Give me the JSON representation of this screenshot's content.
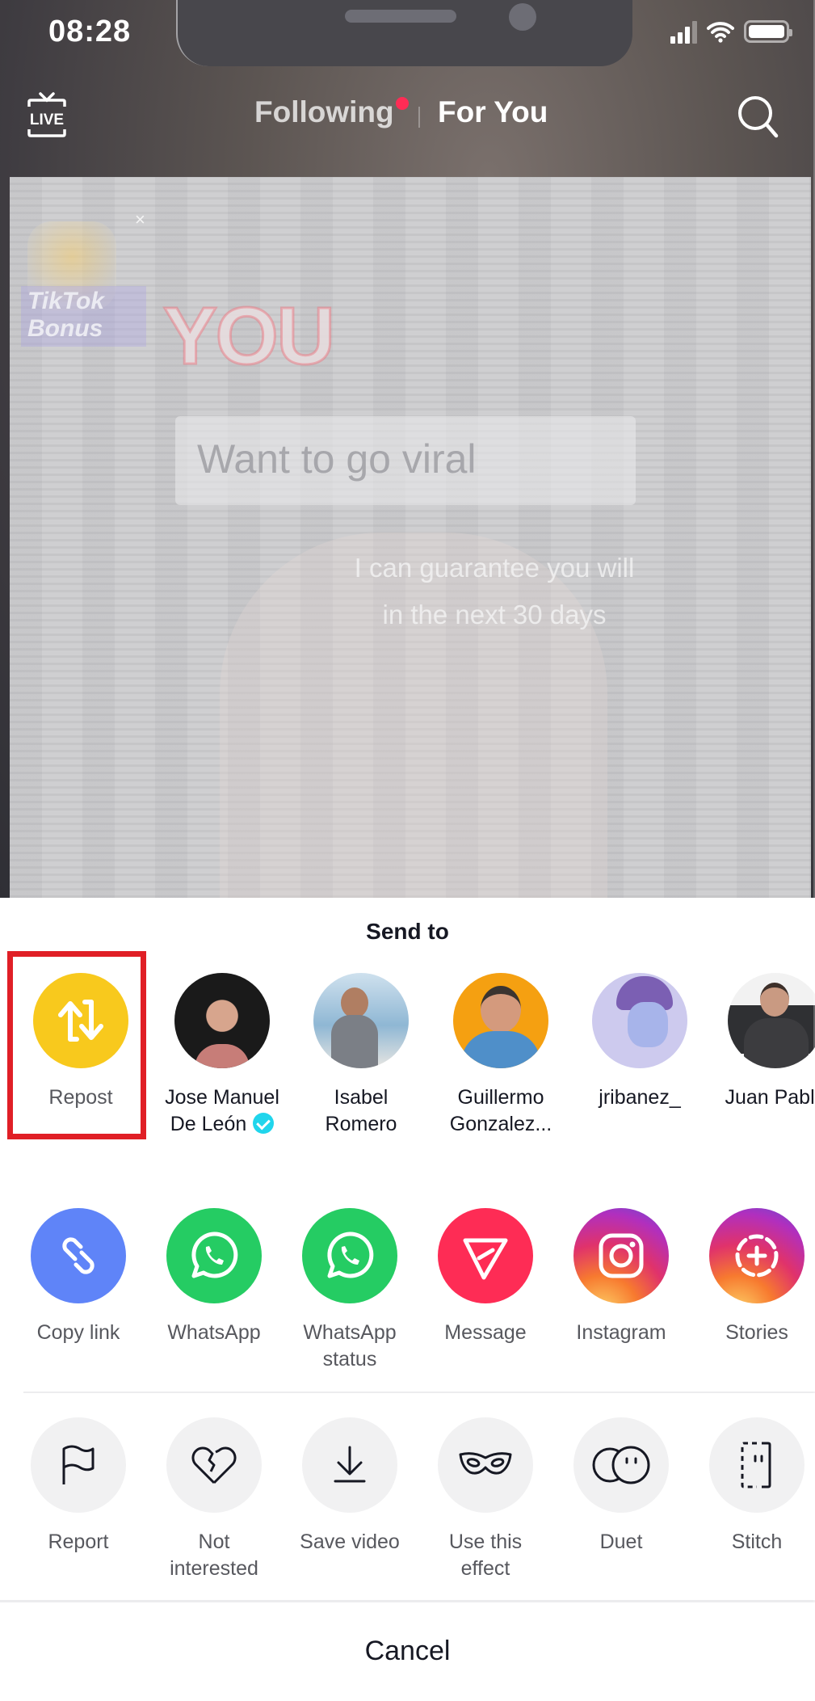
{
  "status_bar": {
    "time": "08:28"
  },
  "top_nav": {
    "live_label": "LIVE",
    "tabs": [
      {
        "label": "Following",
        "active": false,
        "has_notification_dot": true
      },
      {
        "label": "For You",
        "active": true
      }
    ]
  },
  "video": {
    "overlay_badge": "TikTok Bonus",
    "headline": "YOU",
    "caption_box": "Want to go viral",
    "caption_lines": [
      "I can guarantee you will",
      "in the next 30 days"
    ]
  },
  "share_sheet": {
    "title": "Send to",
    "contacts": [
      {
        "label": "Repost",
        "type": "action",
        "color": "#f8c91d",
        "highlighted": true
      },
      {
        "label": "Jose Manuel De León",
        "line1": "Jose Manuel",
        "line2": "De León",
        "verified": true,
        "avatar_bg": "#111111"
      },
      {
        "label": "Isabel Romero",
        "line1": "Isabel",
        "line2": "Romero",
        "avatar_bg": "#9ec3dc"
      },
      {
        "label": "Guillermo Gonzalez...",
        "line1": "Guillermo",
        "line2": "Gonzalez...",
        "avatar_bg": "#f5a011"
      },
      {
        "label": "jribanez_",
        "line1": "jribanez_",
        "line2": "",
        "avatar_bg": "#c6c3ea"
      },
      {
        "label": "Juan Pablo",
        "line1": "Juan Pablo",
        "line2": "",
        "avatar_bg": "#3a3a3c"
      }
    ],
    "share_targets": [
      {
        "label": "Copy link",
        "line1": "Copy link",
        "line2": "",
        "icon": "link-icon",
        "color": "#5f84f8"
      },
      {
        "label": "WhatsApp",
        "line1": "WhatsApp",
        "line2": "",
        "icon": "whatsapp-icon",
        "color": "#25cc63"
      },
      {
        "label": "WhatsApp status",
        "line1": "WhatsApp",
        "line2": "status",
        "icon": "whatsapp-icon",
        "color": "#25cc63"
      },
      {
        "label": "Message",
        "line1": "Message",
        "line2": "",
        "icon": "send-icon",
        "color": "#fe2c55"
      },
      {
        "label": "Instagram",
        "line1": "Instagram",
        "line2": "",
        "icon": "instagram-icon",
        "color": "#d6249f"
      },
      {
        "label": "Stories",
        "line1": "Stories",
        "line2": "",
        "icon": "stories-add-icon",
        "color": "#d6249f"
      }
    ],
    "actions": [
      {
        "label": "Report",
        "line1": "Report",
        "line2": "",
        "icon": "flag-icon"
      },
      {
        "label": "Not interested",
        "line1": "Not",
        "line2": "interested",
        "icon": "broken-heart-icon"
      },
      {
        "label": "Save video",
        "line1": "Save video",
        "line2": "",
        "icon": "download-icon"
      },
      {
        "label": "Use this effect",
        "line1": "Use this",
        "line2": "effect",
        "icon": "mask-icon"
      },
      {
        "label": "Duet",
        "line1": "Duet",
        "line2": "",
        "icon": "duet-icon"
      },
      {
        "label": "Stitch",
        "line1": "Stitch",
        "line2": "",
        "icon": "stitch-icon"
      }
    ],
    "cancel_label": "Cancel"
  },
  "colors": {
    "accent_red": "#fe2c55",
    "highlight_box": "#e01f26",
    "repost_yellow": "#f8c91d",
    "verified_cyan": "#20d5ec"
  }
}
